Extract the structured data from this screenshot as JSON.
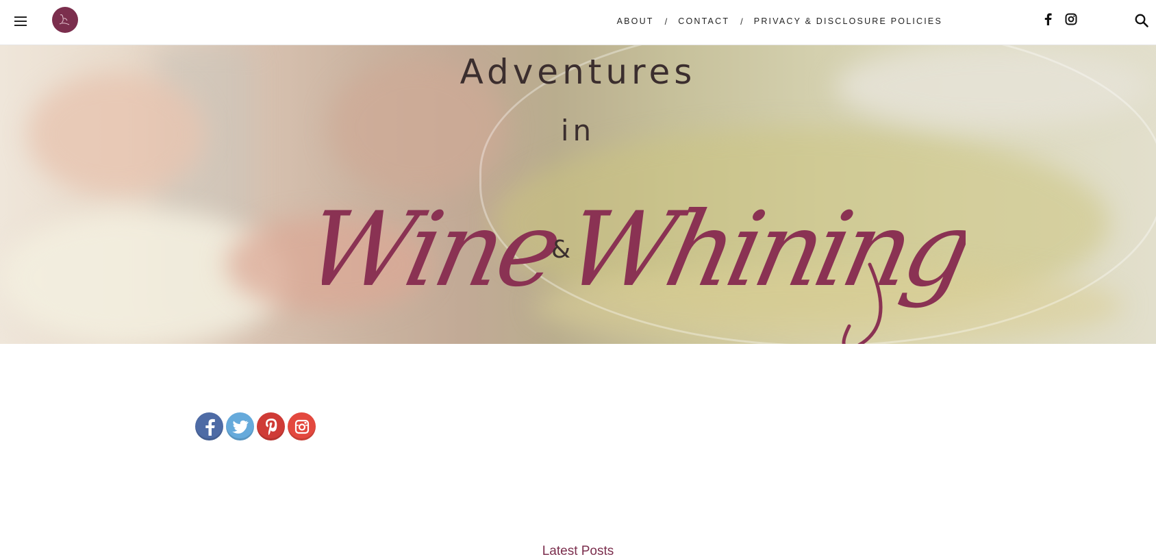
{
  "header": {
    "nav": [
      {
        "label": "ABOUT"
      },
      {
        "label": "CONTACT"
      },
      {
        "label": "PRIVACY & DISCLOSURE POLICIES"
      }
    ],
    "separator": "/",
    "icons": [
      "menu-icon",
      "facebook-icon",
      "instagram-icon",
      "search-icon"
    ]
  },
  "hero": {
    "line1": "Adventures",
    "line2": "in",
    "script_left": "Wine",
    "ampersand": "&",
    "script_right": "Whining"
  },
  "share": {
    "icons": [
      "facebook-icon",
      "twitter-icon",
      "pinterest-icon",
      "instagram-icon"
    ]
  },
  "main": {
    "section_title": "Latest Posts"
  },
  "colors": {
    "brand": "#7b2e4d",
    "text_dark": "#3b2e2e",
    "facebook": "#4e6ba5",
    "twitter": "#66aadb",
    "pinterest": "#cf3b36",
    "instagram": "#e3483e"
  }
}
